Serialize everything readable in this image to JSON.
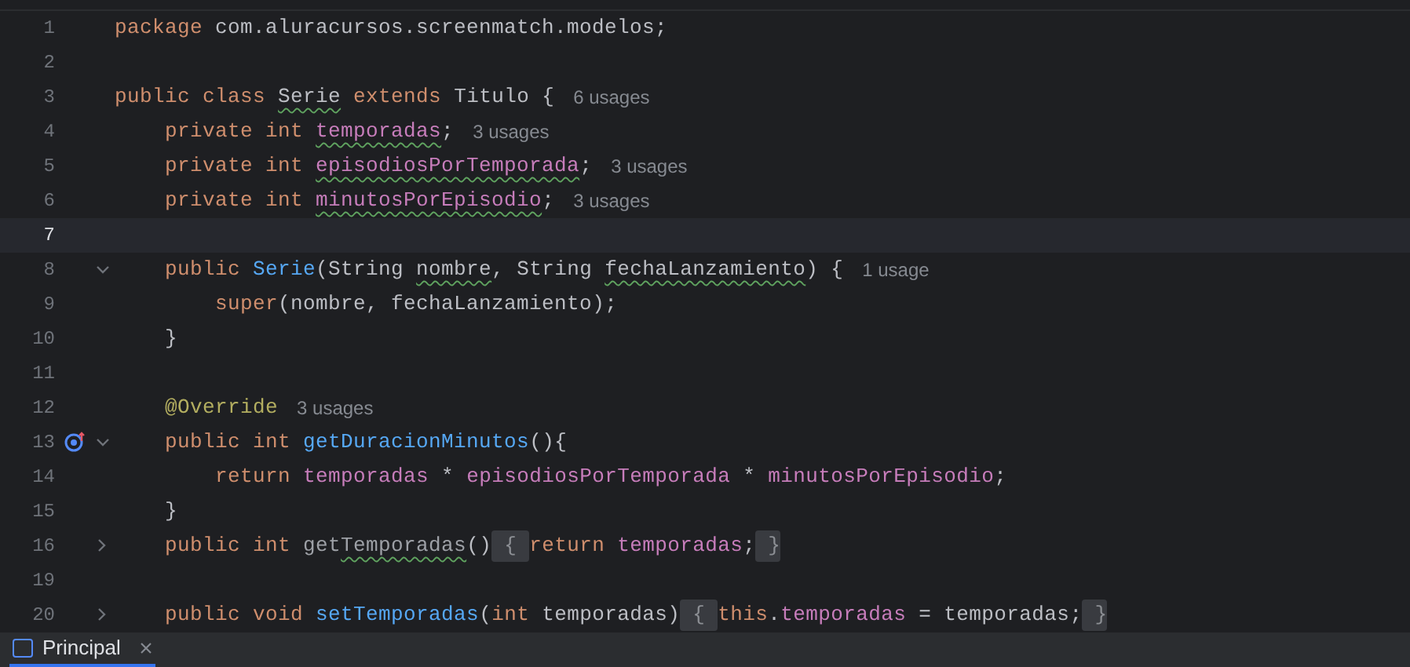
{
  "editor": {
    "lines": [
      {
        "number": "1",
        "current": false,
        "tokens": [
          {
            "t": "package ",
            "kind": "keyword"
          },
          {
            "t": "com.aluracursos.screenmatch.modelos;",
            "kind": "plain"
          }
        ]
      },
      {
        "number": "2",
        "current": false
      },
      {
        "number": "3",
        "current": false,
        "hint": "6 usages",
        "tokens": [
          {
            "t": "public class ",
            "kind": "keyword"
          },
          {
            "t": "Serie",
            "kind": "plain",
            "squiggle": true
          },
          {
            "t": " extends",
            "kind": "keyword"
          },
          {
            "t": " Titulo {",
            "kind": "plain"
          }
        ]
      },
      {
        "number": "4",
        "current": false,
        "hint": "3 usages",
        "tokens": [
          {
            "t": "    private int ",
            "kind": "keyword"
          },
          {
            "t": "temporadas",
            "kind": "field",
            "squiggle": true
          },
          {
            "t": ";",
            "kind": "plain"
          }
        ]
      },
      {
        "number": "5",
        "current": false,
        "hint": "3 usages",
        "tokens": [
          {
            "t": "    private int ",
            "kind": "keyword"
          },
          {
            "t": "episodiosPorTemporada",
            "kind": "field",
            "squiggle": true
          },
          {
            "t": ";",
            "kind": "plain"
          }
        ]
      },
      {
        "number": "6",
        "current": false,
        "hint": "3 usages",
        "tokens": [
          {
            "t": "    private int ",
            "kind": "keyword"
          },
          {
            "t": "minutosPorEpisodio",
            "kind": "field",
            "squiggle": true
          },
          {
            "t": ";",
            "kind": "plain"
          }
        ]
      },
      {
        "number": "7",
        "current": true
      },
      {
        "number": "8",
        "current": false,
        "expanded": true,
        "hint": "1 usage",
        "tokens": [
          {
            "t": "    public ",
            "kind": "keyword"
          },
          {
            "t": "Serie",
            "kind": "declaration"
          },
          {
            "t": "(String ",
            "kind": "plain"
          },
          {
            "t": "nombre",
            "kind": "plain",
            "squiggle": true
          },
          {
            "t": ", String ",
            "kind": "plain"
          },
          {
            "t": "fechaLanzamiento",
            "kind": "plain",
            "squiggle": true
          },
          {
            "t": ") {",
            "kind": "plain"
          }
        ]
      },
      {
        "number": "9",
        "current": false,
        "tokens": [
          {
            "t": "        super",
            "kind": "keyword"
          },
          {
            "t": "(nombre, fechaLanzamiento);",
            "kind": "plain"
          }
        ]
      },
      {
        "number": "10",
        "current": false,
        "tokens": [
          {
            "t": "    }",
            "kind": "plain"
          }
        ]
      },
      {
        "number": "11",
        "current": false
      },
      {
        "number": "12",
        "current": false,
        "hint": "3 usages",
        "tokens": [
          {
            "t": "    @Override",
            "kind": "annotation"
          }
        ]
      },
      {
        "number": "13",
        "current": false,
        "expanded": true,
        "overrides": true,
        "tokens": [
          {
            "t": "    public int ",
            "kind": "keyword"
          },
          {
            "t": "getDuracionMinutos",
            "kind": "declaration"
          },
          {
            "t": "(){",
            "kind": "plain"
          }
        ]
      },
      {
        "number": "14",
        "current": false,
        "tokens": [
          {
            "t": "        return ",
            "kind": "keyword"
          },
          {
            "t": "temporadas",
            "kind": "field"
          },
          {
            "t": " * ",
            "kind": "plain"
          },
          {
            "t": "episodiosPorTemporada",
            "kind": "field"
          },
          {
            "t": " * ",
            "kind": "plain"
          },
          {
            "t": "minutosPorEpisodio",
            "kind": "field"
          },
          {
            "t": ";",
            "kind": "plain"
          }
        ]
      },
      {
        "number": "15",
        "current": false,
        "tokens": [
          {
            "t": "    }",
            "kind": "plain"
          }
        ]
      },
      {
        "number": "16",
        "current": false,
        "expanded": false,
        "tokens": [
          {
            "t": "    public int ",
            "kind": "keyword"
          },
          {
            "t": "get",
            "kind": "unused"
          },
          {
            "t": "Temporadas",
            "kind": "unused",
            "squiggle": true
          },
          {
            "t": "()",
            "kind": "plain"
          },
          {
            "t": " { ",
            "kind": "folded"
          },
          {
            "t": "return ",
            "kind": "keyword"
          },
          {
            "t": "temporadas",
            "kind": "field"
          },
          {
            "t": ";",
            "kind": "plain"
          },
          {
            "t": " }",
            "kind": "folded"
          }
        ]
      },
      {
        "number": "19",
        "current": false
      },
      {
        "number": "20",
        "current": false,
        "expanded": false,
        "tokens": [
          {
            "t": "    public void ",
            "kind": "keyword"
          },
          {
            "t": "setTemporadas",
            "kind": "declaration"
          },
          {
            "t": "(",
            "kind": "plain"
          },
          {
            "t": "int ",
            "kind": "keyword"
          },
          {
            "t": "temporadas)",
            "kind": "plain"
          },
          {
            "t": " { ",
            "kind": "folded"
          },
          {
            "t": "this",
            "kind": "keyword"
          },
          {
            "t": ".",
            "kind": "plain"
          },
          {
            "t": "temporadas",
            "kind": "field"
          },
          {
            "t": " = temporadas;",
            "kind": "plain"
          },
          {
            "t": " }",
            "kind": "folded"
          }
        ]
      }
    ]
  },
  "bottom_panel": {
    "tabs": [
      {
        "label": "Principal",
        "selected": true
      }
    ]
  }
}
